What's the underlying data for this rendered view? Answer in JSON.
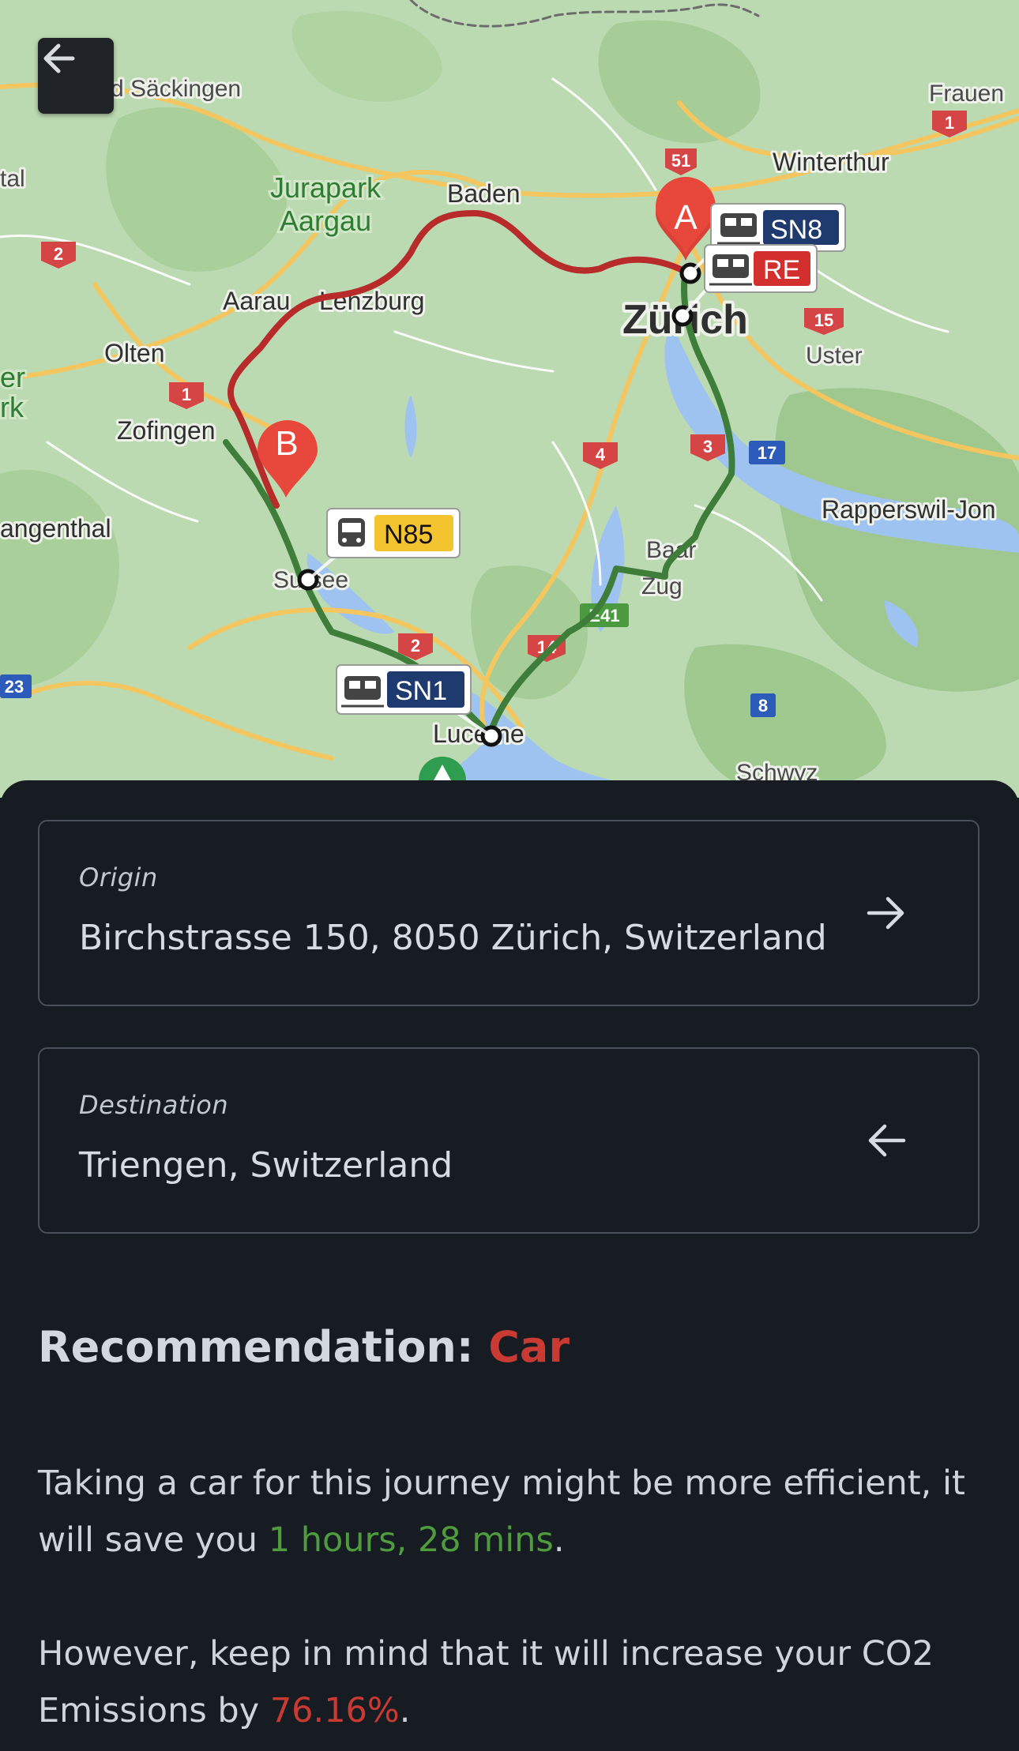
{
  "map": {
    "places": {
      "saeckingen": "d Säckingen",
      "frauenfeld": "Frauen",
      "tal": "tal",
      "winterthur": "Winterthur",
      "jurapark_1": "Jurapark",
      "jurapark_2": "Aargau",
      "baden": "Baden",
      "aarau": "Aarau",
      "lenzburg": "Lenzburg",
      "zurich": "Zürich",
      "uster": "Uster",
      "olten": "Olten",
      "er": "er",
      "rk": "rk",
      "zofingen": "Zofingen",
      "rapperswil": "Rapperswil-Jon",
      "langenthal": "angenthal",
      "baar": "Baar",
      "zug": "Zug",
      "sursee": "Sursee",
      "lucerne": "Lucerne",
      "schwyz": "Schwyz"
    },
    "road_shields": {
      "r51": "51",
      "r1a": "1",
      "r2a": "2",
      "r15": "15",
      "r1b": "1",
      "r4": "4",
      "r3": "3",
      "r17": "17",
      "r2b": "2",
      "r14": "14",
      "e41": "E41",
      "r23": "23",
      "r8": "8"
    },
    "markers": {
      "origin": "A",
      "destination": "B"
    },
    "transit_badges": [
      {
        "label": "SN8",
        "mode": "train",
        "color": "#1f3a6e"
      },
      {
        "label": "RE",
        "mode": "train",
        "color": "#d32f2f"
      },
      {
        "label": "N85",
        "mode": "bus",
        "color": "#f4c430"
      },
      {
        "label": "SN1",
        "mode": "train",
        "color": "#1f3a6e"
      }
    ],
    "route_colors": {
      "car": "#b72b2b",
      "transit": "#3f7d3a"
    }
  },
  "back_button": {
    "icon": "arrow-left-icon"
  },
  "origin": {
    "label": "Origin",
    "value": "Birchstrasse 150, 8050 Zürich, Switzerland",
    "icon": "arrow-right-icon"
  },
  "destination": {
    "label": "Destination",
    "value": "Triengen, Switzerland",
    "icon": "arrow-left-icon"
  },
  "recommendation": {
    "prefix": "Recommendation:",
    "mode": "Car",
    "mode_color": "#c83a32",
    "savings_text_before": "Taking a car for this journey might be more efficient, it will save you",
    "time_saved": "1 hours, 28 mins",
    "savings_text_after": ".",
    "emissions_text_before": "However, keep in mind that it will increase your CO2 Emissions by",
    "emissions_increase": "76.16%",
    "emissions_text_after": "."
  }
}
